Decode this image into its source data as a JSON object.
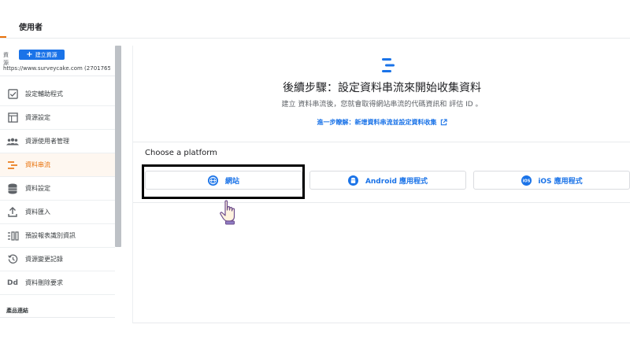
{
  "header": {
    "title": "使用者"
  },
  "sidebar": {
    "resource_label": "資源",
    "create_button": "建立資源",
    "property_url": "https://www.surveycake.com (2701765...",
    "items": [
      {
        "label": "設定輔助程式",
        "icon": "checkbox-icon"
      },
      {
        "label": "資源設定",
        "icon": "layout-icon"
      },
      {
        "label": "資源使用者管理",
        "icon": "people-icon"
      },
      {
        "label": "資料串流",
        "icon": "streams-icon"
      },
      {
        "label": "資料設定",
        "icon": "database-icon"
      },
      {
        "label": "資料匯入",
        "icon": "upload-icon"
      },
      {
        "label": "預設報表識別資訊",
        "icon": "reporting-identity-icon"
      },
      {
        "label": "資源變更記錄",
        "icon": "history-icon"
      },
      {
        "label": "資料刪除要求",
        "icon": "dd-icon"
      }
    ],
    "active_index": 3,
    "section_label": "產品連結"
  },
  "main": {
    "headline": "後續步驟：設定資料串流來開始收集資料",
    "subline": "建立 資料串流後，您就會取得網站串流的代碼資訊和 評估 ID 。",
    "learn_prefix": "進一步瞭解：",
    "learn_link": "新增資料串流並設定資料收集",
    "platform_title": "Choose a platform",
    "platforms": [
      {
        "label": "網站",
        "icon": "globe-icon"
      },
      {
        "label": "Android 應用程式",
        "icon": "android-icon"
      },
      {
        "label": "iOS 應用程式",
        "icon": "ios-icon"
      }
    ]
  },
  "colors": {
    "accent_blue": "#1a73e8",
    "accent_orange": "#e8710a",
    "highlight": "#000000"
  }
}
